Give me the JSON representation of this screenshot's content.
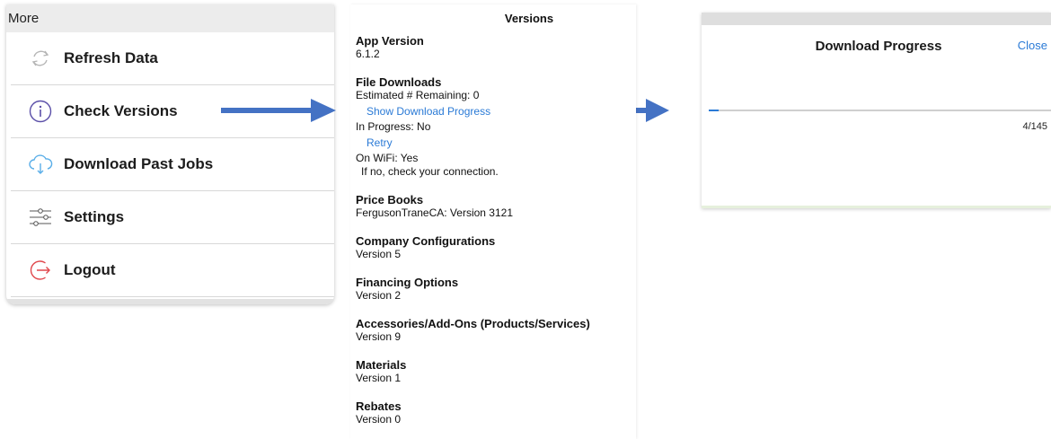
{
  "menu": {
    "header": "More",
    "items": [
      {
        "label": "Refresh Data",
        "icon": "refresh-icon"
      },
      {
        "label": "Check Versions",
        "icon": "info-icon"
      },
      {
        "label": "Download Past Jobs",
        "icon": "cloud-download-icon"
      },
      {
        "label": "Settings",
        "icon": "sliders-icon"
      },
      {
        "label": "Logout",
        "icon": "logout-icon"
      }
    ]
  },
  "versions": {
    "title": "Versions",
    "app_version": {
      "heading": "App Version",
      "value": "6.1.2"
    },
    "file_downloads": {
      "heading": "File Downloads",
      "remaining": "Estimated # Remaining: 0",
      "show_progress_link": "Show Download Progress",
      "in_progress": "In Progress: No",
      "retry_link": "Retry",
      "on_wifi": "On WiFi: Yes",
      "wifi_hint": "If no, check your connection."
    },
    "price_books": {
      "heading": "Price Books",
      "value": "FergusonTraneCA: Version 3121"
    },
    "company_configurations": {
      "heading": "Company Configurations",
      "value": "Version 5"
    },
    "financing_options": {
      "heading": "Financing Options",
      "value": "Version 2"
    },
    "accessories": {
      "heading": "Accessories/Add-Ons (Products/Services)",
      "value": "Version 9"
    },
    "materials": {
      "heading": "Materials",
      "value": "Version 1"
    },
    "rebates": {
      "heading": "Rebates",
      "value": "Version 0"
    }
  },
  "progress": {
    "title": "Download Progress",
    "close_label": "Close",
    "count_text": "4/145",
    "completed": 4,
    "total": 145
  },
  "colors": {
    "arrow": "#4472c4",
    "link": "#2a7ad6",
    "logout_icon": "#e0474c",
    "download_icon": "#5aaee8",
    "info_icon": "#5b4fa8",
    "refresh_icon": "#b5b5b5",
    "settings_icon": "#555555"
  }
}
